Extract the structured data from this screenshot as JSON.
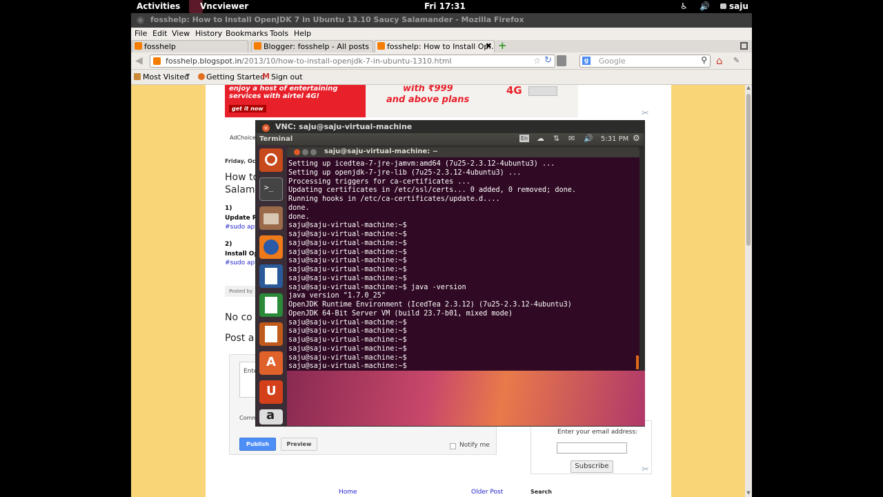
{
  "topbar": {
    "activities": "Activities",
    "app": "Vncviewer",
    "clock": "Fri 17:31",
    "user": "saju"
  },
  "firefox": {
    "title": "fosshelp: How to Install OpenJDK 7 in Ubuntu 13.10 Saucy Salamander - Mozilla Firefox",
    "menu": [
      "File",
      "Edit",
      "View",
      "History",
      "Bookmarks",
      "Tools",
      "Help"
    ],
    "tabs": [
      {
        "label": "fosshelp"
      },
      {
        "label": "Blogger: fosshelp - All posts"
      },
      {
        "label": "fosshelp: How to Install Op..."
      }
    ],
    "url": {
      "host": "fosshelp.blogspot.in",
      "path": "/2013/10/how-to-install-openjdk-7-in-ubuntu-1310.html"
    },
    "search_placeholder": "Google",
    "bookmarks": [
      "Most Visited",
      "Getting Started",
      "Sign out"
    ]
  },
  "blog": {
    "ad_line1": "enjoy a host of entertaining",
    "ad_line2": "services with airtel 4G!",
    "ad_button": "get it now",
    "ad_price": "with ₹999",
    "ad_price2": "and above plans",
    "ad_4g": "4G",
    "adchoices": "AdChoices",
    "date": "Friday, Octo",
    "post_title1": "How to",
    "post_title2": "Salam",
    "step1": "1)",
    "step1_text": "Update Re",
    "step1_cmd": "#sudo apt-",
    "step2": "2)",
    "step2_text": "Install Op",
    "step2_cmd": "#sudo apt-",
    "posted_by": "Posted by",
    "no_comments": "No co",
    "post_a": "Post a",
    "comment_placeholder": "Ente",
    "comment_as": "Comm",
    "publish": "Publish",
    "preview": "Preview",
    "notify": "Notify me",
    "email_label": "Enter your email address:",
    "subscribe": "Subscribe",
    "search_label": "Search",
    "home": "Home",
    "older": "Older Post"
  },
  "vnc": {
    "title": "VNC: saju@saju-virtual-machine",
    "panel_app": "Terminal",
    "lang": "En",
    "time": "5:31 PM",
    "term_title": "saju@saju-virtual-machine: ~",
    "lines": [
      "Setting up icedtea-7-jre-jamvm:amd64 (7u25-2.3.12-4ubuntu3) ...",
      "Setting up openjdk-7-jre-lib (7u25-2.3.12-4ubuntu3) ...",
      "Processing triggers for ca-certificates ...",
      "Updating certificates in /etc/ssl/certs... 0 added, 0 removed; done.",
      "Running hooks in /etc/ca-certificates/update.d....",
      "done.",
      "done.",
      "saju@saju-virtual-machine:~$",
      "saju@saju-virtual-machine:~$",
      "saju@saju-virtual-machine:~$",
      "saju@saju-virtual-machine:~$",
      "saju@saju-virtual-machine:~$",
      "saju@saju-virtual-machine:~$",
      "saju@saju-virtual-machine:~$",
      "saju@saju-virtual-machine:~$ java -version",
      "java version \"1.7.0_25\"",
      "OpenJDK Runtime Environment (IcedTea 2.3.12) (7u25-2.3.12-4ubuntu3)",
      "OpenJDK 64-Bit Server VM (build 23.7-b01, mixed mode)",
      "saju@saju-virtual-machine:~$",
      "saju@saju-virtual-machine:~$",
      "saju@saju-virtual-machine:~$",
      "saju@saju-virtual-machine:~$",
      "saju@saju-virtual-machine:~$",
      "saju@saju-virtual-machine:~$"
    ]
  }
}
